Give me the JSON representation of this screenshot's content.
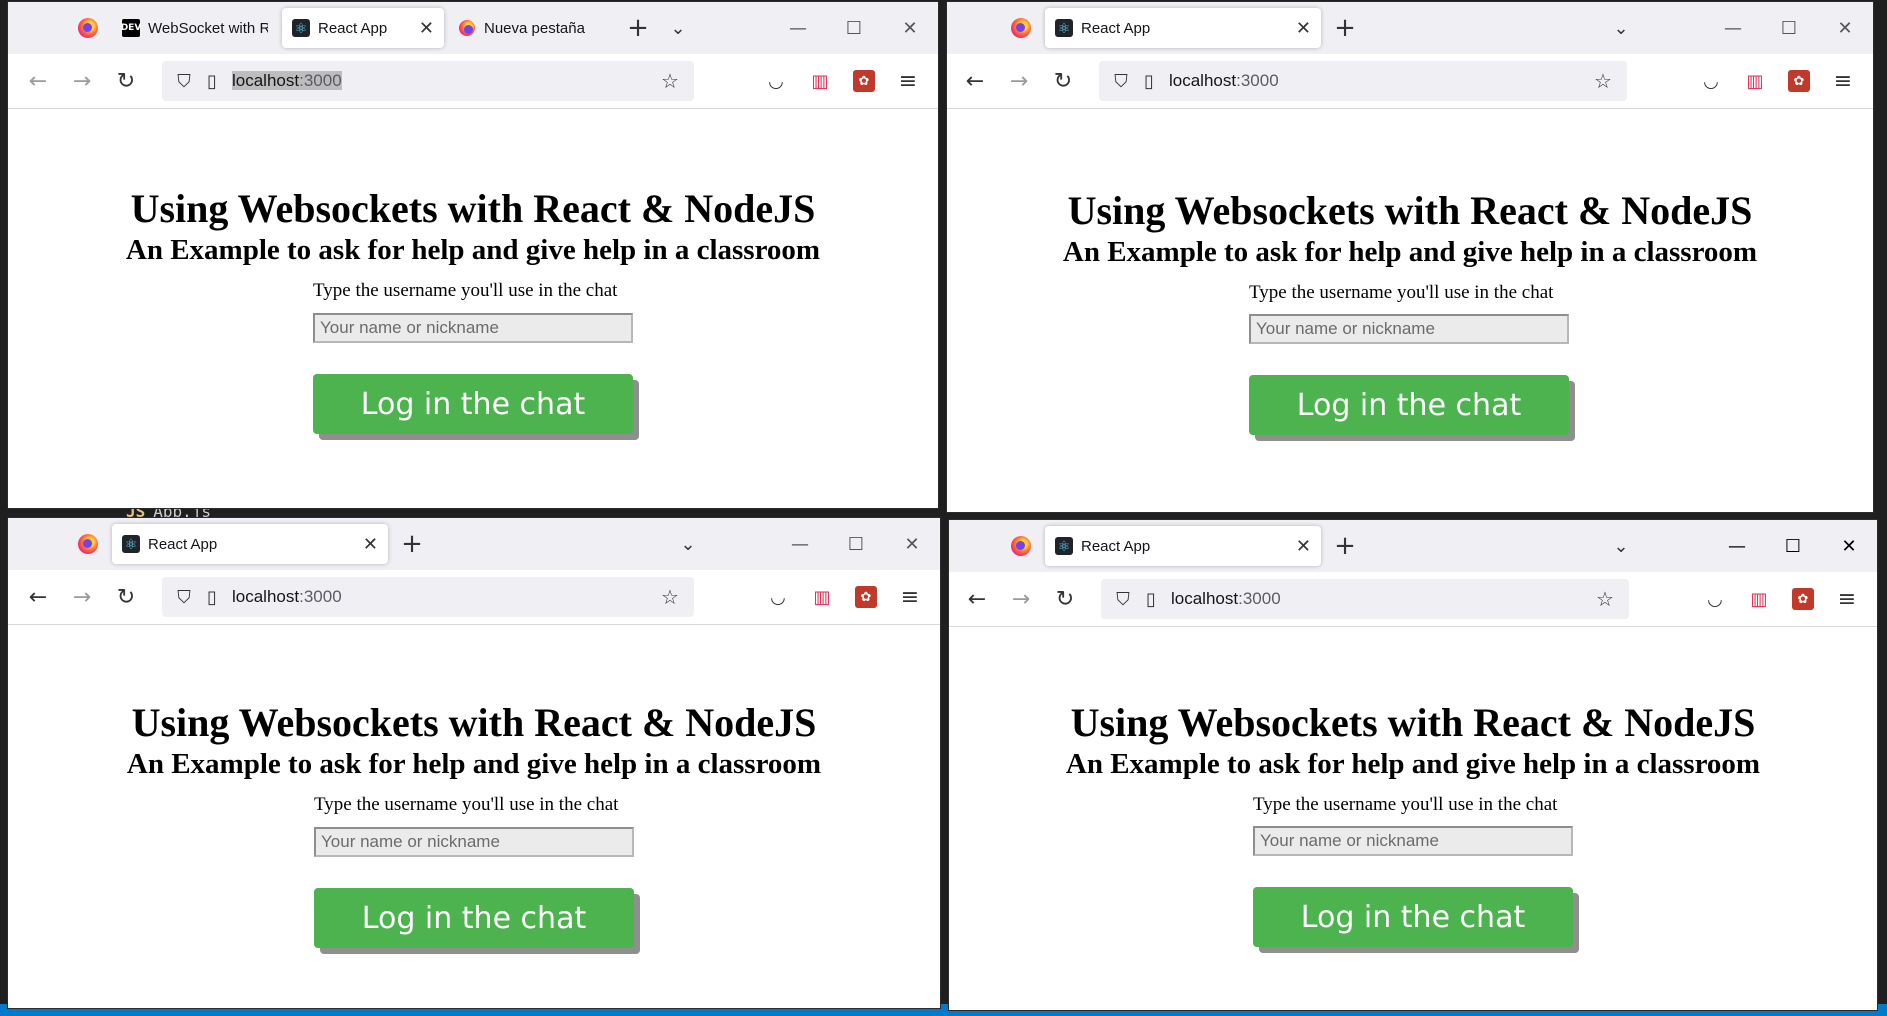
{
  "background": {
    "file_label_prefix": "JS",
    "file_label": "App.js",
    "editor_color": "#1f1f1f",
    "statusbar_color": "#007acc"
  },
  "page": {
    "heading": "Using Websockets with React & NodeJS",
    "subheading": "An Example to ask for help and give help in a classroom",
    "username_label": "Type the username you'll use in the chat",
    "username_placeholder": "Your name or nickname",
    "login_button": "Log in the chat",
    "button_color": "#4cb34f"
  },
  "windows": [
    {
      "tabs": [
        {
          "title": "WebSocket with R",
          "favicon": "dev-icon",
          "active": false
        },
        {
          "title": "React App",
          "favicon": "react-icon",
          "active": true
        },
        {
          "title": "Nueva pestaña",
          "favicon": "firefox-icon",
          "active": false
        }
      ],
      "url_host": "localhost",
      "url_port": ":3000",
      "url_selected": true
    },
    {
      "tabs": [
        {
          "title": "React App",
          "favicon": "react-icon",
          "active": true
        }
      ],
      "url_host": "localhost",
      "url_port": ":3000",
      "url_selected": false
    },
    {
      "tabs": [
        {
          "title": "React App",
          "favicon": "react-icon",
          "active": true
        }
      ],
      "url_host": "localhost",
      "url_port": ":3000",
      "url_selected": false
    },
    {
      "tabs": [
        {
          "title": "React App",
          "favicon": "react-icon",
          "active": true
        }
      ],
      "url_host": "localhost",
      "url_port": ":3000",
      "url_selected": false
    }
  ],
  "icons": {
    "tab_close": "✕",
    "new_tab": "+",
    "list_tabs": "⌄",
    "minimize": "—",
    "maximize": "☐",
    "close": "✕",
    "back": "←",
    "forward": "→",
    "reload": "↻",
    "shield": "⛉",
    "page": "▯",
    "star": "☆",
    "pocket": "◡",
    "ext1": "▥",
    "ext2": "✿",
    "menu": "≡"
  }
}
